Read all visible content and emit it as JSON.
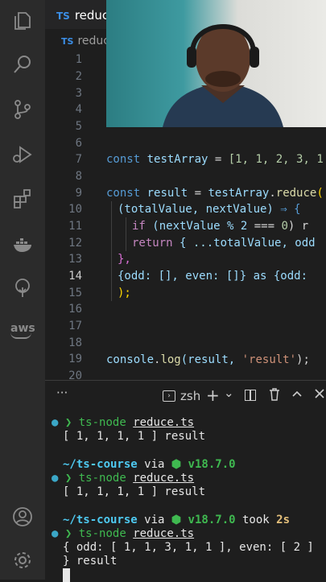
{
  "tab": {
    "lang": "TS",
    "name": "reduce"
  },
  "breadcrumb": {
    "lang": "TS",
    "name": "reduce"
  },
  "line_numbers": [
    "1",
    "2",
    "3",
    "4",
    "5",
    "6",
    "7",
    "8",
    "9",
    "10",
    "11",
    "12",
    "13",
    "14",
    "15",
    "16",
    "17",
    "18",
    "19",
    "20"
  ],
  "active_line": "14",
  "code": {
    "l7": {
      "kw": "const",
      "var": "testArray",
      "eq": " = ",
      "vals": "[1, 1, 2, 3, 1"
    },
    "l9": {
      "kw": "const",
      "var": "result",
      "eq": " = ",
      "obj": "testArray",
      "fn": "reduce",
      "open": "("
    },
    "l10": {
      "params": "(totalValue, nextValue)",
      "arrow": " ⇒ {"
    },
    "l11": {
      "kw": "if",
      "expr": " (nextValue % 2 ",
      "op": "===",
      "num": " 0",
      "rest": ") r"
    },
    "l12": {
      "kw": "return",
      "rest": " { ...totalValue, odd"
    },
    "l13": {
      "text": "},"
    },
    "l14": {
      "text": "{odd: [], even: []} as {odd:"
    },
    "l15": {
      "text": ");"
    },
    "l19": {
      "obj": "console",
      "fn": "log",
      "args": "(result, ",
      "str": "'result'",
      "end": ");"
    }
  },
  "panel": {
    "more": "···",
    "shell": "zsh",
    "add": "+",
    "chev": "⌄"
  },
  "terminal": {
    "cmd1": "ts-node",
    "file1": "reduce.ts",
    "out1": "[ 1, 1, 1, 1 ] result",
    "dir": "~/ts-course",
    "via": " via ",
    "node_icon": "⬢",
    "ver": "v18.7.0",
    "cmd2": "ts-node",
    "file2": "reduce.ts",
    "out2": "[ 1, 1, 1, 1 ] result",
    "took": " took ",
    "time": "2s",
    "cmd3": "ts-node",
    "file3": "reduce.ts",
    "out3a": "{ odd: [ 1, 1, 3, 1, 1 ], even: [ 2 ]",
    "out3b": "} result"
  }
}
